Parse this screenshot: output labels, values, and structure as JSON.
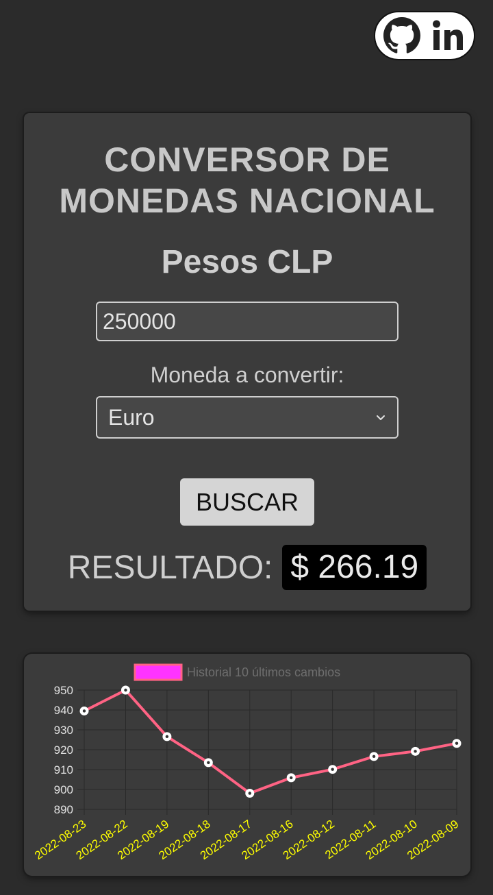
{
  "header": {
    "links": [
      {
        "icon": "github-icon"
      },
      {
        "icon": "linkedin-icon"
      }
    ]
  },
  "converter": {
    "title_line1": "CONVERSOR DE",
    "title_line2": "MONEDAS NACIONAL",
    "subtitle": "Pesos CLP",
    "amount_value": "250000",
    "currency_label": "Moneda a convertir:",
    "currency_selected": "Euro",
    "search_label": "BUSCAR",
    "result_label": "RESULTADO:",
    "result_value": "$ 266.19"
  },
  "chart_data": {
    "type": "line",
    "legend": "Historial 10 últimos cambios",
    "x": [
      "2022-08-23",
      "2022-08-22",
      "2022-08-19",
      "2022-08-18",
      "2022-08-17",
      "2022-08-16",
      "2022-08-12",
      "2022-08-11",
      "2022-08-10",
      "2022-08-09"
    ],
    "series": [
      {
        "name": "Historial 10 últimos cambios",
        "values": [
          939.5,
          950.0,
          926.6,
          913.5,
          898.1,
          905.9,
          910.1,
          916.6,
          919.2,
          923.2
        ]
      }
    ],
    "ylim": [
      890,
      950
    ],
    "yticks": [
      890,
      900,
      910,
      920,
      930,
      940,
      950
    ],
    "line_color": "#ff6384",
    "legend_color": "#ff33ff",
    "tick_label_color_x": "#ffff00",
    "grid": true
  }
}
